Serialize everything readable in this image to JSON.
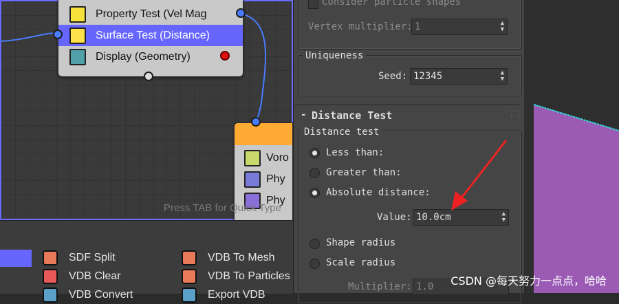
{
  "graph": {
    "node_main": {
      "rows": [
        {
          "label": "Property Test (Vel Mag"
        },
        {
          "label": "Surface Test (Distance)"
        },
        {
          "label": "Display (Geometry)"
        }
      ]
    },
    "node_orange": {
      "rows": [
        {
          "label": "Voro"
        },
        {
          "label": "Phy"
        },
        {
          "label": "Phy"
        }
      ]
    },
    "hint": "Press TAB for Quick Type"
  },
  "palette": {
    "col1": [
      "SDF Split",
      "VDB Clear",
      "VDB Convert"
    ],
    "col2": [
      "VDB To Mesh",
      "VDB To Particles",
      "Export VDB"
    ]
  },
  "panel": {
    "top_partial": {
      "checkbox_label": "Consider particle shapes",
      "vertex_multiplier_label": "Vertex multiplier:",
      "vertex_multiplier_value": "1"
    },
    "uniqueness": {
      "title": "Uniqueness",
      "seed_label": "Seed:",
      "seed_value": "12345"
    },
    "distance_rollout": {
      "toggle": "-",
      "title": "Distance Test",
      "group_label": "Distance test",
      "options": [
        {
          "label": "Less than:",
          "selected": false
        },
        {
          "label": "Greater than:",
          "selected": false
        },
        {
          "label": "Absolute distance:",
          "selected": true
        }
      ],
      "value_label": "Value:",
      "value": "10.0cm",
      "radius_options": [
        {
          "label": "Shape radius",
          "selected": false
        },
        {
          "label": "Scale radius",
          "selected": false
        }
      ],
      "multiplier_label": "Multiplier:",
      "multiplier_value": "1.0"
    }
  },
  "watermark": "CSDN @每天努力一点点，哈哈",
  "colors": {
    "selection": "#6666ff",
    "wire": "#4a7cff",
    "orange_node": "#ffaa33",
    "viewport_purple": "#9b5bb5",
    "viewport_edge": "#33dddd",
    "arrow": "#ee2222"
  }
}
